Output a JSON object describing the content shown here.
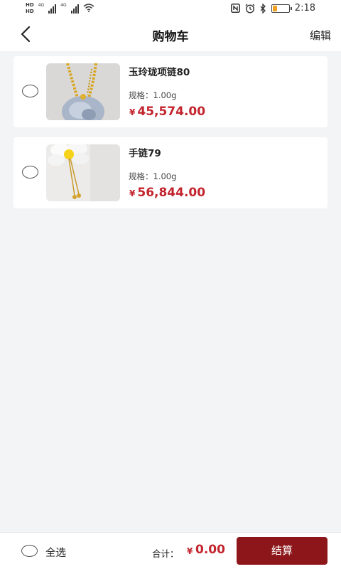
{
  "status_bar": {
    "hd1": "HD",
    "hd2": "HD",
    "net1": "4G",
    "net2": "4G",
    "time": "2:18",
    "battery_level": 0.25,
    "icons": [
      "nfc-icon",
      "alarm-icon",
      "bluetooth-icon",
      "battery-icon",
      "wifi-icon",
      "signal-icon"
    ]
  },
  "nav": {
    "title": "购物车",
    "edit_label": "编辑",
    "back_icon": "chevron-left-icon"
  },
  "items": [
    {
      "name": "玉玲珑项链80",
      "spec": "规格：1.00g",
      "currency": "¥",
      "price": "45,574.00",
      "checked": false
    },
    {
      "name": "手链79",
      "spec": "规格：1.00g",
      "currency": "¥",
      "price": "56,844.00",
      "checked": false
    }
  ],
  "bottom": {
    "select_all_label": "全选",
    "total_label": "合计：",
    "total_currency": "¥",
    "total_value": "0.00",
    "checkout_label": "结算"
  },
  "colors": {
    "price": "#c3252e",
    "checkout_button": "#8c1619",
    "background": "#f3f4f6"
  }
}
